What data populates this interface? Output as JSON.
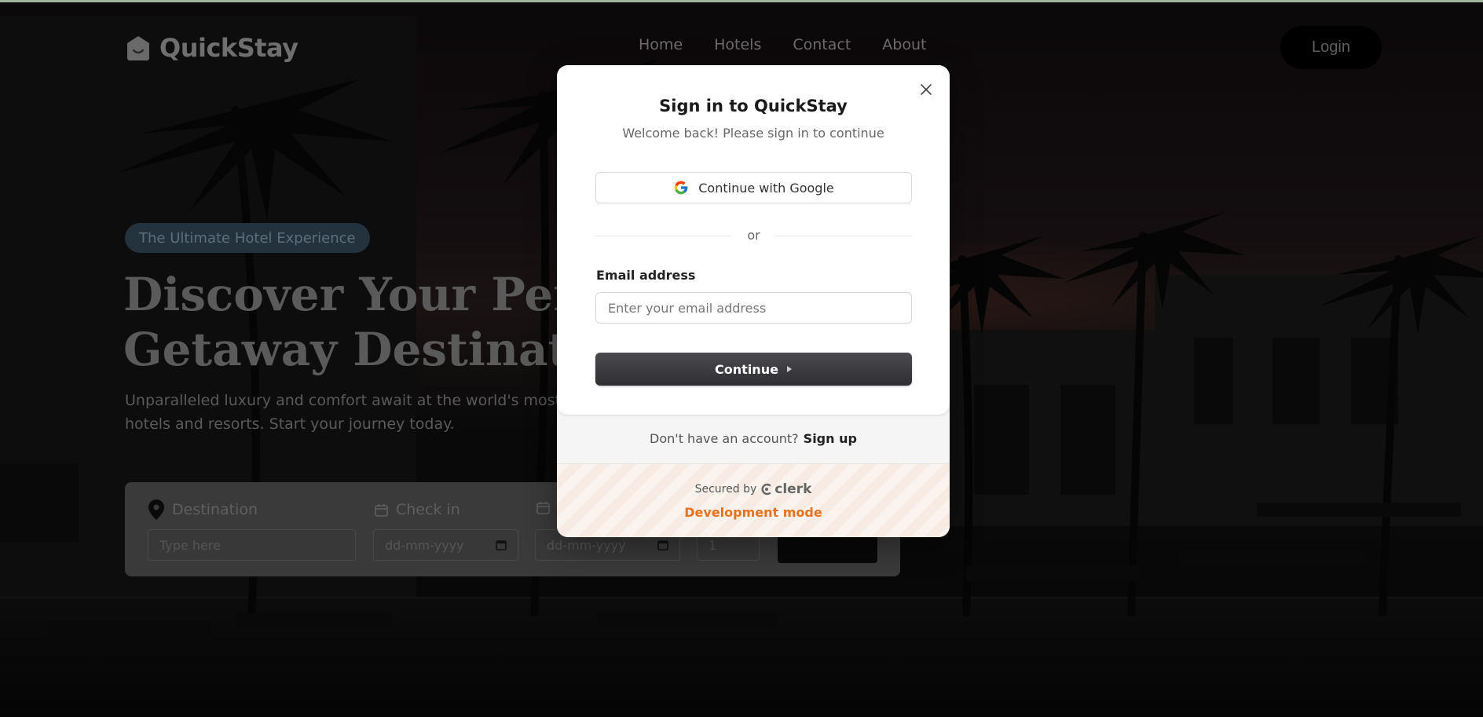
{
  "brand": {
    "name": "QuickStay"
  },
  "nav": {
    "links": [
      "Home",
      "Hotels",
      "Contact",
      "About"
    ],
    "login_label": "Login"
  },
  "hero": {
    "badge": "The Ultimate Hotel Experience",
    "title_line1": "Discover Your Perfe",
    "title_line2": "Getaway Destinatio",
    "subtitle_line1": "Unparalleled luxury and comfort await at the world's most excl",
    "subtitle_line2": "hotels and resorts. Start your journey today."
  },
  "search": {
    "destination_label": "Destination",
    "destination_placeholder": "Type here",
    "checkin_label": "Check in",
    "checkin_placeholder": "dd-mm-yyyy",
    "checkout_placeholder": "dd-mm-yyyy",
    "guests_value": "1"
  },
  "modal": {
    "title": "Sign in to QuickStay",
    "subtitle": "Welcome back! Please sign in to continue",
    "google_label": "Continue with Google",
    "divider_text": "or",
    "email_label": "Email address",
    "email_placeholder": "Enter your email address",
    "continue_label": "Continue",
    "no_account_text": "Don't have an account?",
    "signup_label": "Sign up",
    "secured_by": "Secured by",
    "clerk_label": "clerk",
    "dev_mode": "Development mode"
  },
  "colors": {
    "dev_mode": "#e6731c",
    "continue_bg": "#2e2e33",
    "overlay": "rgba(0,0,0,0.55)"
  }
}
